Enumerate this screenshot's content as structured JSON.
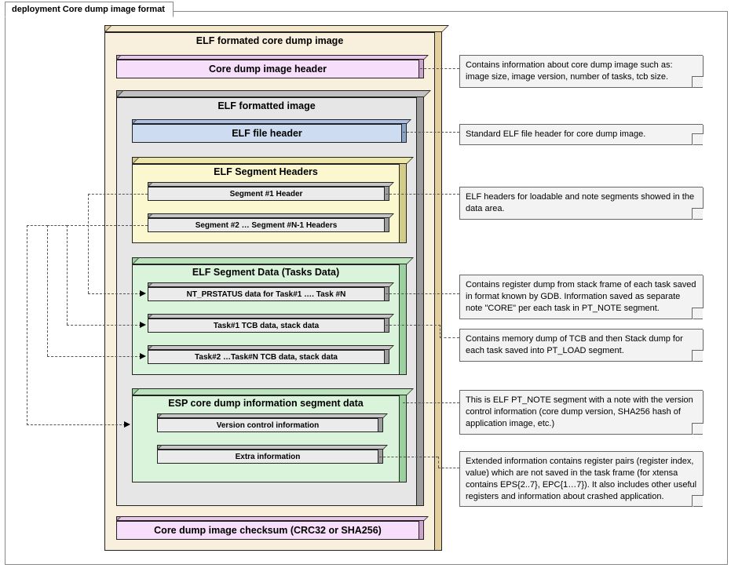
{
  "header": {
    "tab": "deployment Core dump image format"
  },
  "outer": {
    "title": "ELF formated core dump image"
  },
  "bars": {
    "core_header": "Core dump image header",
    "checksum": "Core dump image checksum (CRC32 or SHA256)"
  },
  "elf_image": {
    "title": "ELF formatted image",
    "file_header": "ELF file header",
    "seg_headers": {
      "title": "ELF Segment Headers",
      "h1": "Segment #1 Header",
      "hN": "Segment #2 … Segment #N-1 Headers"
    },
    "seg_data": {
      "title": "ELF Segment Data (Tasks Data)",
      "prstatus": "NT_PRSTATUS data for Task#1 …. Task #N",
      "t1": "Task#1 TCB data, stack data",
      "tN": "Task#2 …Task#N TCB data,  stack data"
    },
    "esp_info": {
      "title": "ESP core dump information segment data",
      "vc": "Version control information",
      "extra": "Extra information"
    }
  },
  "notes": {
    "n1": "Contains information about core dump image such as: image size, image version, number of tasks, tcb size.",
    "n2": "Standard ELF file header for core dump image.",
    "n3": "ELF headers for loadable and note segments showed in the data area.",
    "n4": "Contains register dump from stack frame of each task saved in format known by GDB. Information saved as separate note \"CORE\" per each task in PT_NOTE segment.",
    "n5": "Contains memory dump of TCB and then Stack dump for each task saved into PT_LOAD segment.",
    "n6": "This is ELF PT_NOTE segment with a note with the version control information (core dump version, SHA256 hash of application image, etc.)",
    "n7": "Extended information contains register pairs (register index, value) which are not saved in the task frame (for xtensa contains EPS{2..7}, EPC{1…7}). It also includes other useful registers and information about crashed application."
  }
}
